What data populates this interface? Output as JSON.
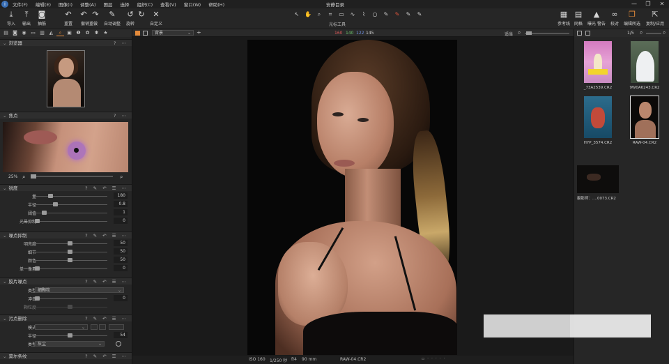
{
  "menubar": {
    "items": [
      "文件(F)",
      "编辑(E)",
      "图像(I)",
      "调整(A)",
      "图层",
      "选择",
      "组织(C)",
      "查看(V)",
      "窗口(W)",
      "帮助(H)"
    ],
    "title": "安静目录",
    "window_controls": [
      "—",
      "❐",
      "✕"
    ]
  },
  "toolbar": {
    "left": [
      {
        "label": "导入",
        "icon": "⤓"
      },
      {
        "label": "输出",
        "icon": "⤒"
      },
      {
        "label": "抽筋",
        "icon": "◙"
      },
      {
        "label": "重置",
        "icon": "↶"
      },
      {
        "label": "",
        "icon": "↶"
      },
      {
        "label": "撤销重做",
        "icon": "↷"
      },
      {
        "label": "自动调整",
        "icon": "✎"
      },
      {
        "label": "旋转",
        "icon": "↺"
      },
      {
        "label": "",
        "icon": "↻"
      },
      {
        "label": "自定义",
        "icon": "✕"
      }
    ],
    "center_tools": [
      "↖",
      "✋",
      "⌕",
      "⌗",
      "▭",
      "∿",
      "⌇",
      "○",
      "✎",
      "✎",
      "✎",
      "✎"
    ],
    "center_label": "光标工具",
    "right": [
      {
        "label": "参考线",
        "icon": "▦"
      },
      {
        "label": "网格",
        "icon": "▤"
      },
      {
        "label": "曝光 警告",
        "icon": "▲"
      },
      {
        "label": "校对",
        "icon": "∞"
      },
      {
        "label": "编辑所选",
        "icon": "❐"
      },
      {
        "label": "复制/应用",
        "icon": "⇱"
      }
    ]
  },
  "left_panel": {
    "tab_icons": [
      "▤",
      "◙",
      "◉",
      "▭",
      "▥",
      "◭",
      "⌕",
      "▣",
      "❶",
      "✿",
      "✱",
      "★"
    ],
    "sections": {
      "browser": "浏览器",
      "focus": "焦点",
      "focus_zoom": "25%",
      "sharpening": "锐度",
      "noise": "噪点抑制",
      "film_grain": "胶片噪点",
      "spot_removal": "污点删除",
      "moire": "莫尔条纹"
    },
    "sharpening_rows": [
      {
        "label": "量",
        "value": "180",
        "pos": 0.2
      },
      {
        "label": "半径",
        "value": "0.8",
        "pos": 0.27
      },
      {
        "label": "阈值",
        "value": "1",
        "pos": 0.1
      },
      {
        "label": "光晕抑制",
        "value": "0",
        "pos": 0.0
      }
    ],
    "noise_rows": [
      {
        "label": "明亮度",
        "value": "50",
        "pos": 0.48
      },
      {
        "label": "细节",
        "value": "50",
        "pos": 0.48
      },
      {
        "label": "颜色",
        "value": "50",
        "pos": 0.48
      },
      {
        "label": "单一像素",
        "value": "0",
        "pos": 0.0
      }
    ],
    "grain": {
      "type_label": "类型",
      "type_value": "细颗粒",
      "impact_label": "冲击",
      "impact_value": "0",
      "impact_pos": 0.0,
      "granularity_label": "颗粒度",
      "granularity_pos": 0.48
    },
    "spot": {
      "mode_label": "模式",
      "mode_value": "",
      "radius_label": "半径",
      "radius_value": "54",
      "radius_pos": 0.48,
      "type_label": "类型",
      "type_value": "灰尘"
    }
  },
  "viewer": {
    "mode": "背景",
    "rgb": {
      "r": "160",
      "g": "140",
      "b": "122",
      "a": "145"
    },
    "fit_label": "适当",
    "page": "1/5",
    "footer": {
      "iso": "ISO 160",
      "shutter": "1/250 秒",
      "aperture": "f/4",
      "focal": "90 mm",
      "filename": "RAW-04.CR2"
    }
  },
  "right_panel": {
    "thumbs": [
      {
        "caption": "_73A2539.CR2"
      },
      {
        "caption": "9W0A6243.CR2"
      },
      {
        "caption": "HYP_3574.CR2"
      },
      {
        "caption": "RAW-04.CR2"
      },
      {
        "caption": "摄影师：....0073.CR2"
      }
    ]
  },
  "colors": {
    "accent": "#e48a3a",
    "panel": "#262626",
    "bg": "#1c1c1c"
  }
}
